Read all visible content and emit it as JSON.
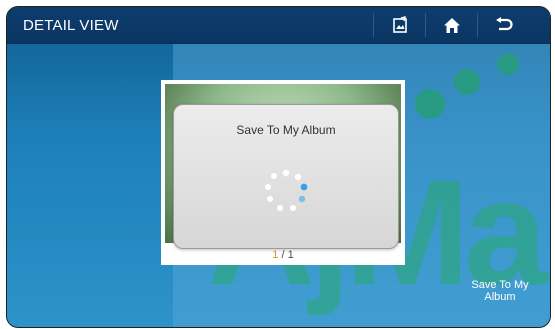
{
  "topbar": {
    "title": "DETAIL VIEW",
    "buttons": [
      {
        "name": "edit-photo-button",
        "icon": "edit-photo-icon"
      },
      {
        "name": "home-button",
        "icon": "home-icon"
      },
      {
        "name": "back-button",
        "icon": "back-arrow-icon"
      }
    ]
  },
  "photo": {
    "counter_current": "1",
    "counter_rest": " / 1"
  },
  "dialog": {
    "message": "Save To My Album",
    "icon": "loading-spinner-icon"
  },
  "actions": {
    "save_to_album": "Save To My Album"
  },
  "watermark": {
    "text": "AjMa"
  },
  "colors": {
    "topbar": "#0a3563",
    "background": "#1d7fb8",
    "dialog": "#e0e0e0",
    "accent_counter": "#d39a22",
    "watermark_green": "#28aa6e"
  }
}
